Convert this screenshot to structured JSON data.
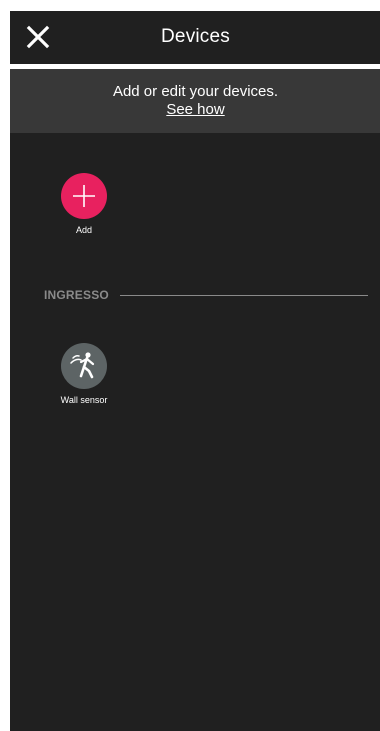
{
  "header": {
    "title": "Devices",
    "close_icon": "close-icon"
  },
  "banner": {
    "text": "Add or edit your devices.",
    "link": "See how"
  },
  "add_device": {
    "label": "Add",
    "icon": "plus-icon",
    "color": "#e8215f"
  },
  "sections": [
    {
      "title": "INGRESSO",
      "devices": [
        {
          "label": "Wall sensor",
          "icon": "motion-sensor-icon",
          "color": "#5d6465"
        }
      ]
    }
  ],
  "colors": {
    "background": "#202020",
    "banner": "#383838",
    "section_label": "#8a8a8a"
  }
}
